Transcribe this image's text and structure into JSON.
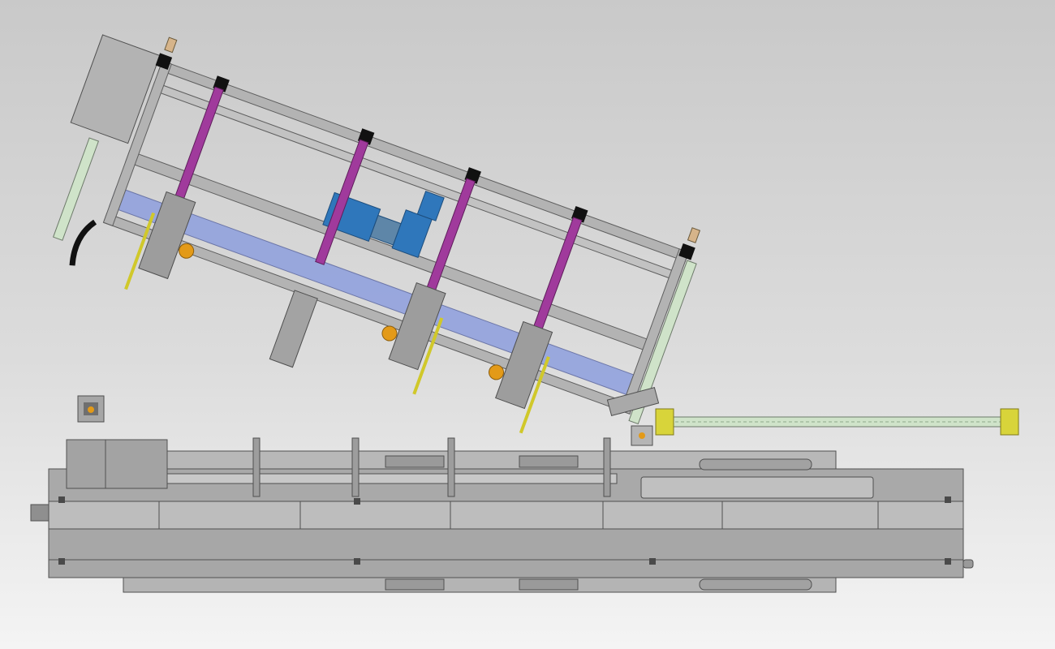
{
  "scene": {
    "background_top": "#c9c9c9",
    "background_bottom": "#f4f4f4",
    "colors": {
      "frame_steel": "#b3b3b3",
      "frame_edge": "#5e5e5e",
      "rail_magenta": "#a03a9c",
      "belt_blue": "#8e9fde",
      "motor_blue": "#2f77bb",
      "encoder_orange": "#e39a18",
      "cable_chain_yellow": "#d8d43a",
      "cable_chain_green": "#cfe3c9",
      "linear_guide_yellow": "#d0c82a",
      "block_black": "#111111"
    }
  },
  "components": {
    "tilted_gantry": "tilted-gantry-assembly",
    "base_machine": "machine-base-bed",
    "cable_chain": "horizontal-cable-chain",
    "control_box": "small-control-box"
  }
}
